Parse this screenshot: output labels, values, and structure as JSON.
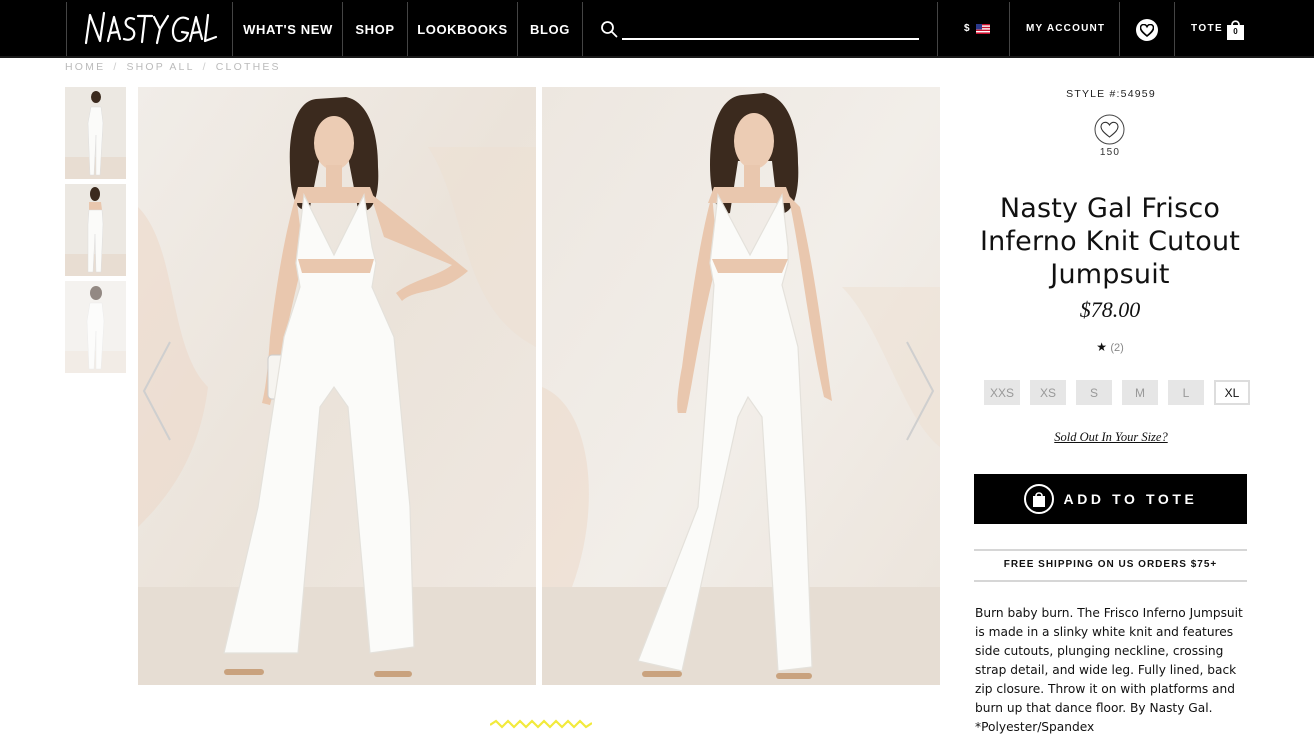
{
  "header": {
    "logo_text": "NASTY GAL",
    "nav": [
      "WHAT'S NEW",
      "SHOP",
      "LOOKBOOKS",
      "BLOG"
    ],
    "search_placeholder": "",
    "currency_symbol": "$",
    "my_account": "MY ACCOUNT",
    "tote_label": "TOTE",
    "tote_count": "0"
  },
  "breadcrumb": [
    "HOME",
    "SHOP ALL",
    "CLOTHES"
  ],
  "breadcrumb_sep": "/",
  "product": {
    "style": "STYLE #:54959",
    "favorites": "150",
    "title": "Nasty Gal Frisco Inferno Knit Cutout Jumpsuit",
    "price": "$78.00",
    "rating_star": "★",
    "rating_count": "(2)",
    "sizes": [
      {
        "label": "XXS",
        "available": false
      },
      {
        "label": "XS",
        "available": false
      },
      {
        "label": "S",
        "available": false
      },
      {
        "label": "M",
        "available": false
      },
      {
        "label": "L",
        "available": false
      },
      {
        "label": "XL",
        "available": true
      }
    ],
    "sold_out_link": "Sold Out In Your Size?",
    "add_to_tote": "ADD TO TOTE",
    "shipping": "FREE SHIPPING ON US ORDERS $75+",
    "description": "Burn baby burn. The Frisco Inferno Jumpsuit is made in a slinky white knit and features side cutouts, plunging neckline, crossing strap detail, and wide leg. Fully lined, back zip closure. Throw it on with platforms and burn up that dance floor. By Nasty Gal.",
    "material": "*Polyester/Spandex"
  },
  "colors": {
    "header_bg": "#000000",
    "photo_wall": "#ece8e2",
    "jumpsuit": "#fbfbf9",
    "hair": "#3b2a1e",
    "skin": "#e9c7ae",
    "loader": "#f2ea3c"
  }
}
